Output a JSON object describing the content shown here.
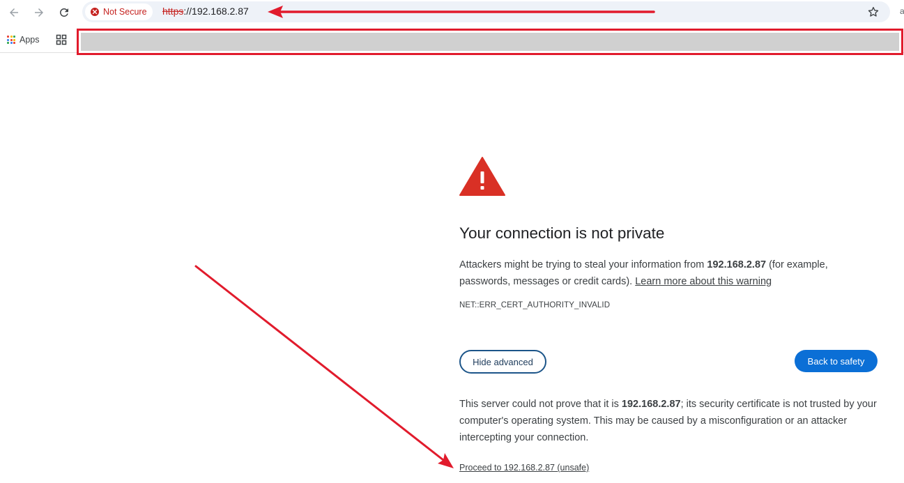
{
  "browser": {
    "security_label": "Not Secure",
    "url_scheme": "https",
    "url_rest": "://192.168.2.87",
    "icons": [
      "back-arrow-icon",
      "forward-arrow-icon",
      "reload-icon",
      "star-icon"
    ],
    "edge_char": "a"
  },
  "bookmarks": {
    "apps_label": "Apps",
    "apps_colors": [
      "#ea4335",
      "#fbbc04",
      "#34a853",
      "#4285f4",
      "#ea4335",
      "#fbbc04",
      "#34a853",
      "#4285f4",
      "#ea4335"
    ]
  },
  "interstitial": {
    "heading": "Your connection is not private",
    "p1_prefix": "Attackers might be trying to steal your information from ",
    "p1_host": "192.168.2.87",
    "p1_suffix": " (for example, passwords, messages or credit cards). ",
    "learn_more": "Learn more about this warning",
    "error_code": "NET::ERR_CERT_AUTHORITY_INVALID",
    "hide_advanced": "Hide advanced",
    "back_to_safety": "Back to safety",
    "p2_prefix": "This server could not prove that it is ",
    "p2_host": "192.168.2.87",
    "p2_suffix": "; its security certificate is not trusted by your computer's operating system. This may be caused by a misconfiguration or an attacker intercepting your connection.",
    "proceed_link": "Proceed to 192.168.2.87 (unsafe)"
  },
  "colors": {
    "danger": "#c5221f",
    "warning_icon": "#d93025",
    "primary_button": "#0b6fd6",
    "annotation_red": "#e11b2c"
  }
}
